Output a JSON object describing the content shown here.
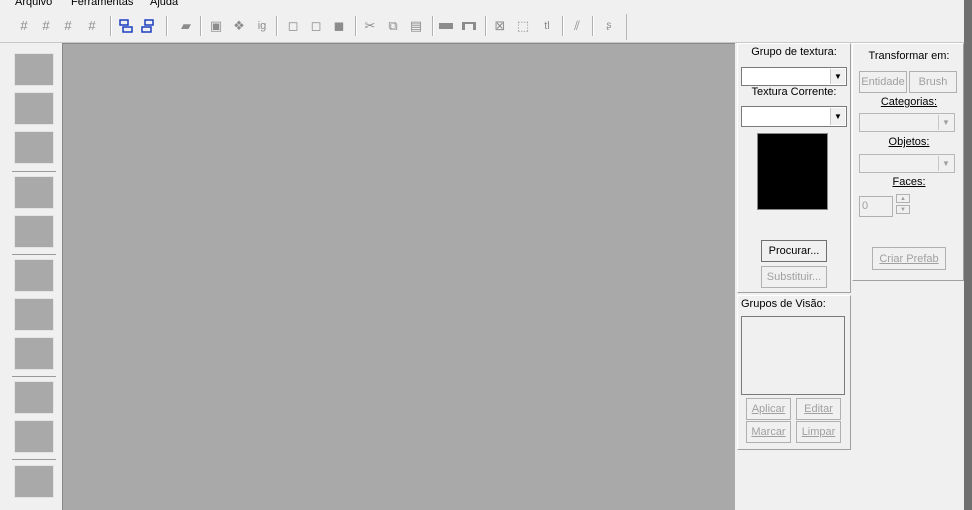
{
  "menu": {
    "items": [
      "Arquivo",
      "Ferramentas",
      "Ajuda"
    ]
  },
  "toolbar": {
    "icons": [
      "grid-icon",
      "grid-numbered-icon",
      "grid-minus-icon",
      "grid-plus-icon",
      "stack-icon",
      "stack-alt-icon",
      "eraser-icon",
      "select-all-icon",
      "group-icon",
      "ig-icon",
      "cube-outline-icon",
      "cube-back-icon",
      "cube-solid-icon",
      "cut-icon",
      "copy-icon",
      "paste-icon",
      "wall-icon",
      "bridge-icon",
      "box-select-icon",
      "dashed-select-icon",
      "text-tl-icon",
      "flip-icon",
      "curve-icon"
    ]
  },
  "texture_panel": {
    "group_label": "Grupo de textura:",
    "current_label": "Textura Corrente:",
    "browse_button": "Procurar...",
    "browse_underline": "P",
    "replace_button": "Substituir...",
    "replace_underline": "S",
    "preview_color": "#000000"
  },
  "vision_panel": {
    "label": "Grupos de Visão:",
    "apply_button": "Aplicar",
    "edit_button": "Editar",
    "mark_button": "Marcar",
    "clear_button": "Limpar"
  },
  "transform_panel": {
    "label": "Transformar em:",
    "entity_button": "Entidade",
    "brush_button": "Brush",
    "categories_label": "Categorias:",
    "objects_label": "Objetos:",
    "faces_label": "Faces:",
    "faces_value": "0",
    "create_prefab_button": "Criar Prefab"
  },
  "colors": {
    "viewport": "#a9a9a9",
    "window": "#f0f0f0",
    "toolbar_accent": "#1a3fbf"
  }
}
